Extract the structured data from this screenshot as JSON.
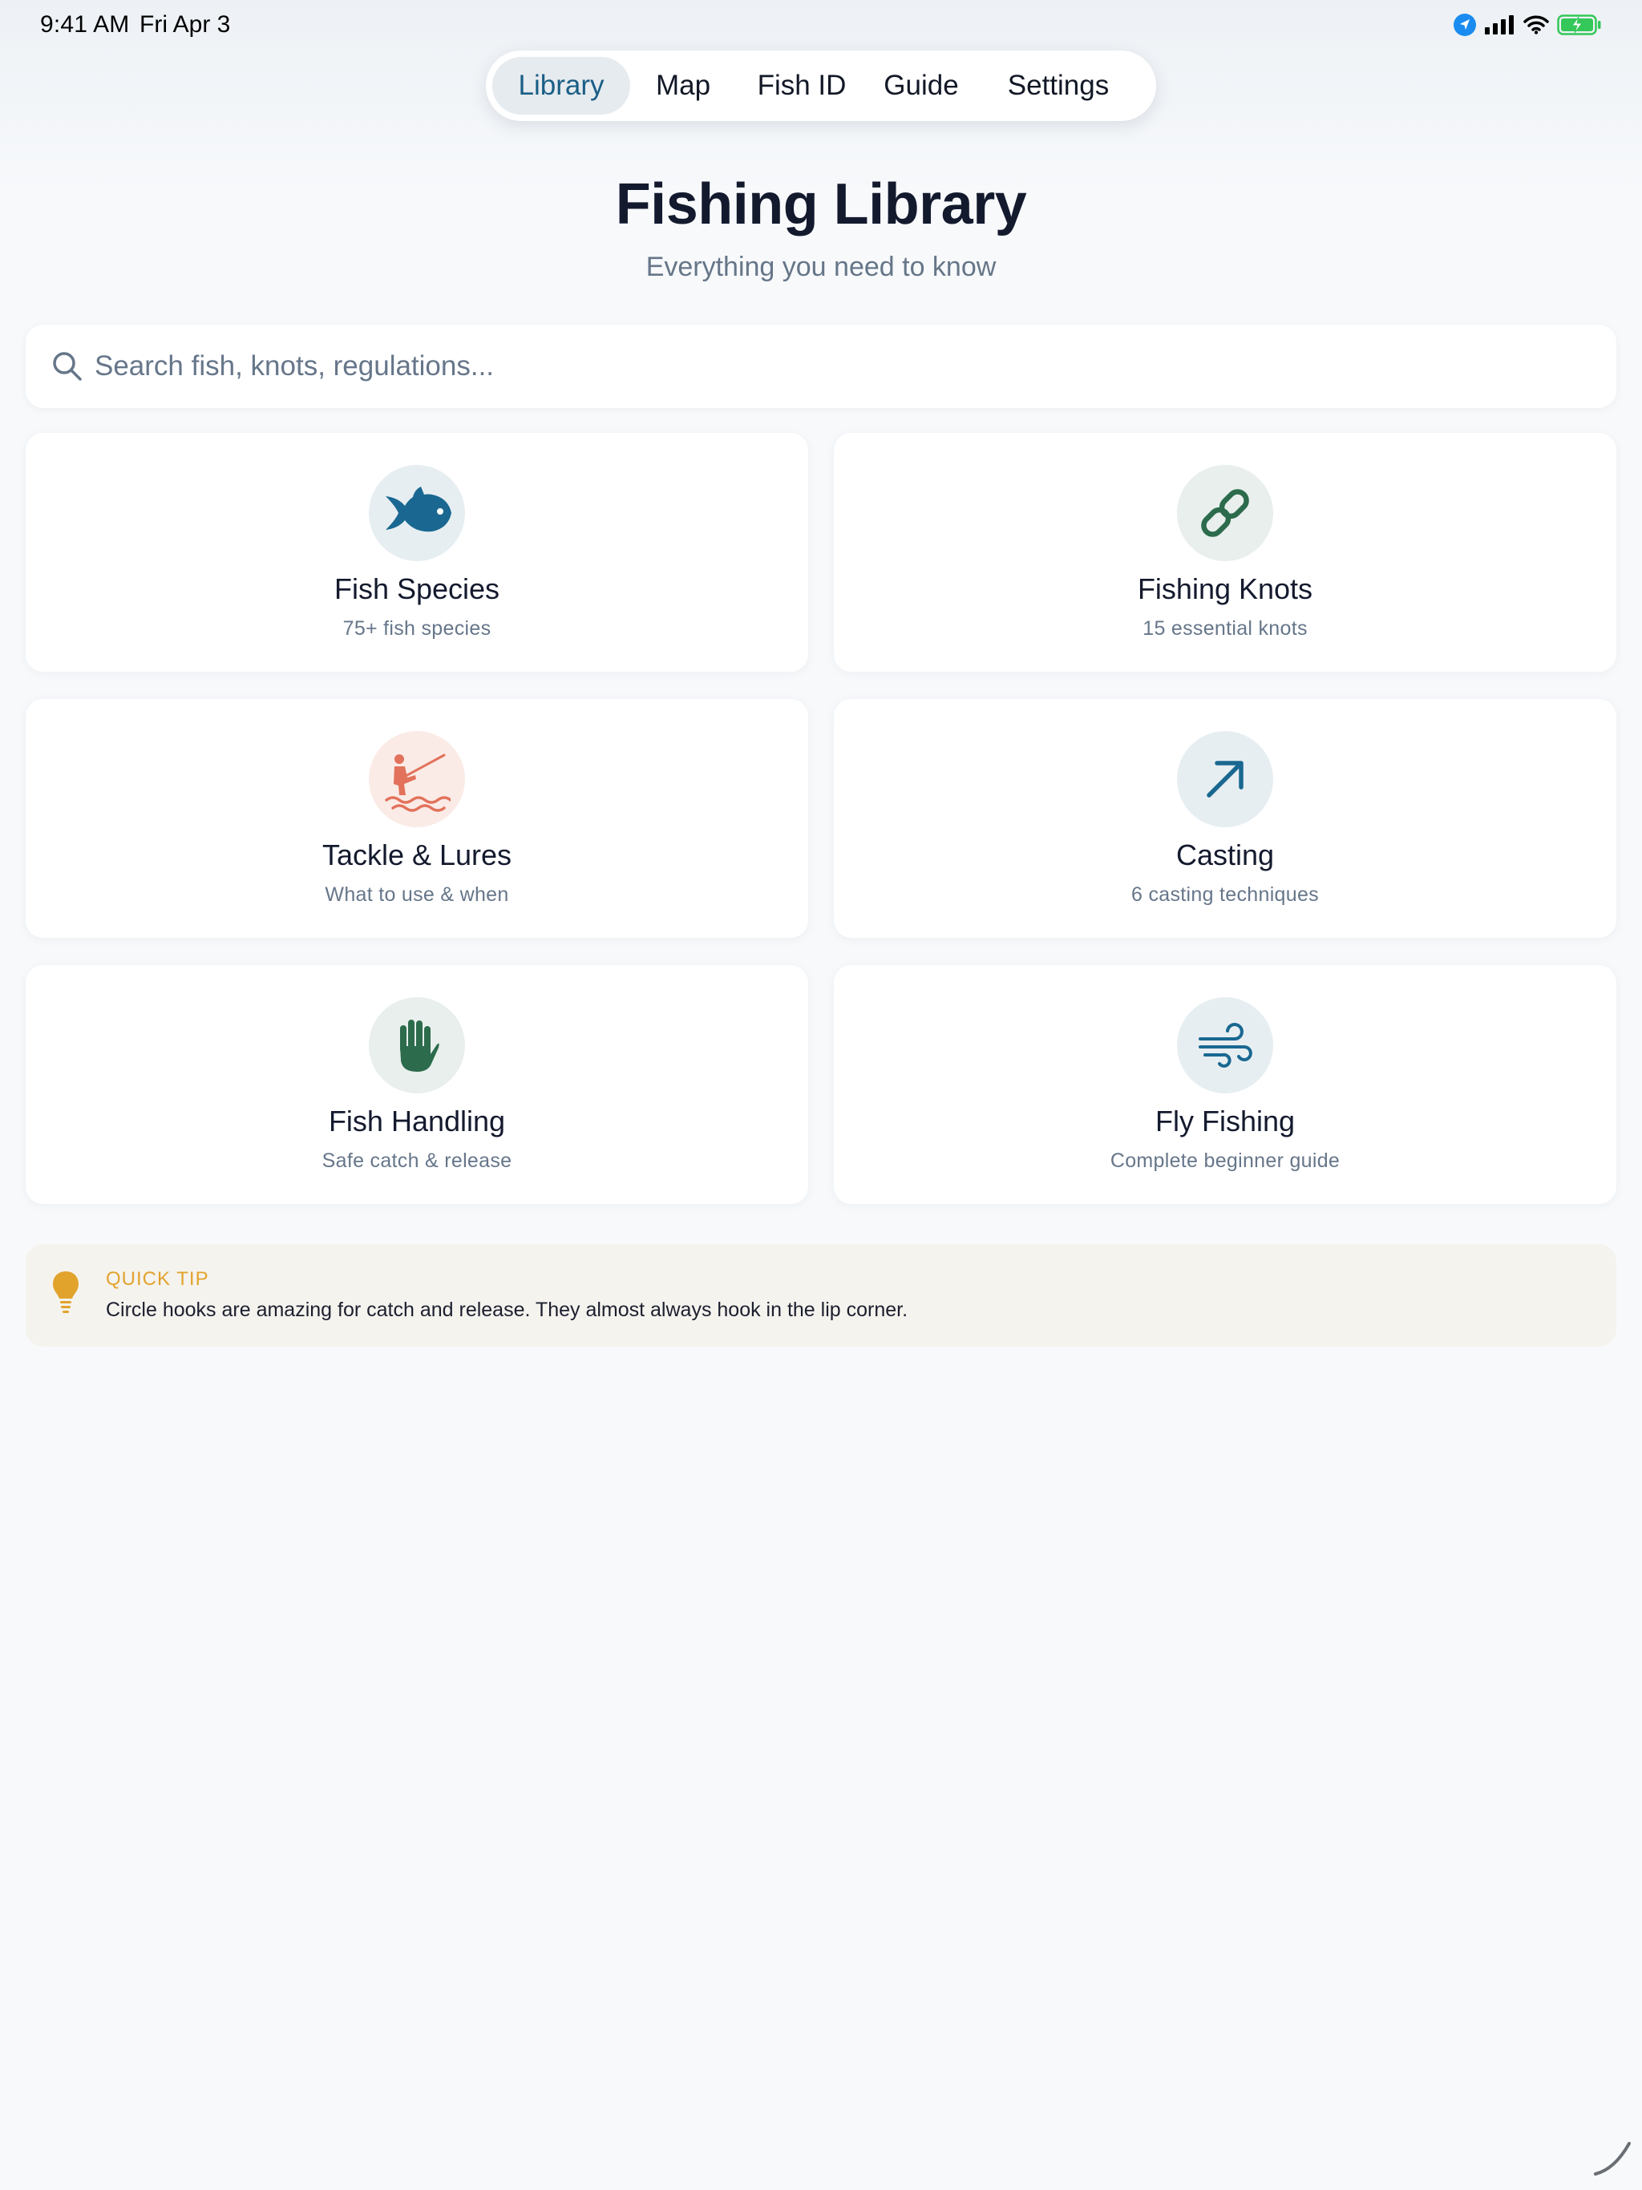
{
  "status_bar": {
    "time": "9:41 AM",
    "date": "Fri Apr 3",
    "icons": [
      "location-icon",
      "cellular-signal-icon",
      "wifi-icon",
      "battery-charging-icon"
    ]
  },
  "tabs": [
    {
      "label": "Library",
      "active": true
    },
    {
      "label": "Map",
      "active": false
    },
    {
      "label": "Fish ID",
      "active": false
    },
    {
      "label": "Guide",
      "active": false
    },
    {
      "label": "Settings",
      "active": false
    }
  ],
  "header": {
    "title": "Fishing Library",
    "subtitle": "Everything you need to know"
  },
  "search": {
    "placeholder": "Search fish, knots, regulations...",
    "value": ""
  },
  "categories": [
    {
      "title": "Fish Species",
      "subtitle": "75+ fish species",
      "icon": "fish-icon",
      "color": "#1a6891",
      "bg": "#e7eef2"
    },
    {
      "title": "Fishing Knots",
      "subtitle": "15 essential knots",
      "icon": "link-icon",
      "color": "#2c6b4c",
      "bg": "#e8efec"
    },
    {
      "title": "Tackle & Lures",
      "subtitle": "What to use & when",
      "icon": "angler-icon",
      "color": "#e2725b",
      "bg": "#fbebe7"
    },
    {
      "title": "Casting",
      "subtitle": "6 casting techniques",
      "icon": "arrow-up-right-icon",
      "color": "#1a6891",
      "bg": "#e7eef2"
    },
    {
      "title": "Fish Handling",
      "subtitle": "Safe catch & release",
      "icon": "hand-icon",
      "color": "#2c6b4c",
      "bg": "#e8efec"
    },
    {
      "title": "Fly Fishing",
      "subtitle": "Complete beginner guide",
      "icon": "wind-icon",
      "color": "#1a6891",
      "bg": "#e7eef2"
    }
  ],
  "quick_tip": {
    "label": "QUICK TIP",
    "text": "Circle hooks are amazing for catch and release. They almost always hook in the lip corner.",
    "icon": "lightbulb-icon",
    "color": "#e2a32d"
  }
}
